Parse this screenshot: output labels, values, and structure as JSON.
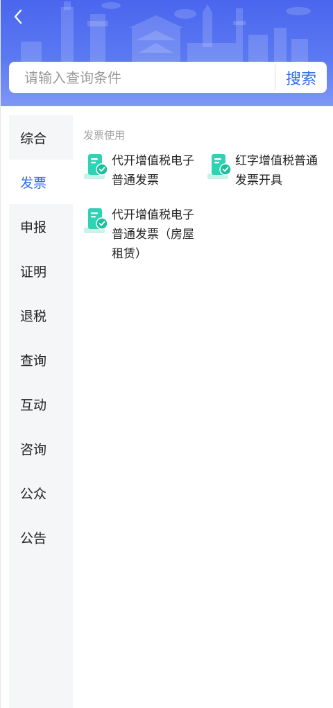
{
  "header": {
    "back_icon": "chevron-left-icon",
    "search": {
      "placeholder": "请输入查询条件",
      "button_label": "搜索"
    },
    "colors": {
      "banner_top": "#4a66ee",
      "banner_bottom": "#7f97f6",
      "accent": "#2f6bf0"
    }
  },
  "sidebar": {
    "items": [
      {
        "label": "综合",
        "active": false
      },
      {
        "label": "发票",
        "active": true
      },
      {
        "label": "申报",
        "active": false
      },
      {
        "label": "证明",
        "active": false
      },
      {
        "label": "退税",
        "active": false
      },
      {
        "label": "查询",
        "active": false
      },
      {
        "label": "互动",
        "active": false
      },
      {
        "label": "咨询",
        "active": false
      },
      {
        "label": "公众",
        "active": false
      },
      {
        "label": "公告",
        "active": false
      }
    ]
  },
  "main": {
    "section_title": "发票使用",
    "services": [
      {
        "label_lines": [
          "代开增值税电子",
          "普通发票"
        ],
        "icon": "invoice-check-icon"
      },
      {
        "label_lines": [
          "红字增值税普通",
          "发票开具"
        ],
        "icon": "invoice-check-icon"
      },
      {
        "label_lines": [
          "代开增值税电子",
          "普通发票（房屋",
          "租赁）"
        ],
        "icon": "invoice-check-icon"
      }
    ]
  }
}
